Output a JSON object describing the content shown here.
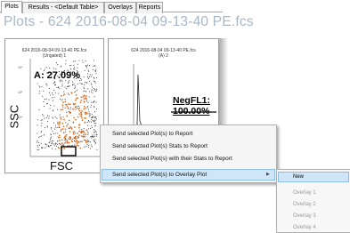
{
  "tabs": [
    {
      "label": "Plots",
      "active": true
    },
    {
      "label": "Results - <Default Table>",
      "active": false
    },
    {
      "label": "Overlays",
      "active": false
    },
    {
      "label": "Reports",
      "active": false
    }
  ],
  "page_title": "Plots - 624 2016-08-04 09-13-40 PE.fcs",
  "plot1": {
    "title_line1": "624 2016-08-04 09-13-40 PE.fcs",
    "title_line2": "(Ungated) 1",
    "gate_label": "A: 27.09%",
    "y_axis_label": "SSC",
    "x_axis_label": "FSC"
  },
  "plot2": {
    "title_line1": "624 2016-08-04 09-13-40 PE.fcs",
    "title_line2": "(A) 2",
    "gate_label": "NegFL1: 100.00%"
  },
  "context_menu": {
    "items": [
      "Send selected Plot(s) to Report",
      "Send selected Plot(s) Stats to Report",
      "Send selected Plot(s) with their Stats to Report",
      "Send selected Plot(s) to Overlay Plot"
    ],
    "submenu_arrow": "▶"
  },
  "submenu": {
    "items": [
      "New",
      "Overlay 1",
      "Overlay 2",
      "Overlay 3",
      "Overlay 4"
    ]
  },
  "colors": {
    "title": "#a8b7c5",
    "selection": "#cfe6f8",
    "dots": "#333333",
    "dense": "#e07020"
  }
}
